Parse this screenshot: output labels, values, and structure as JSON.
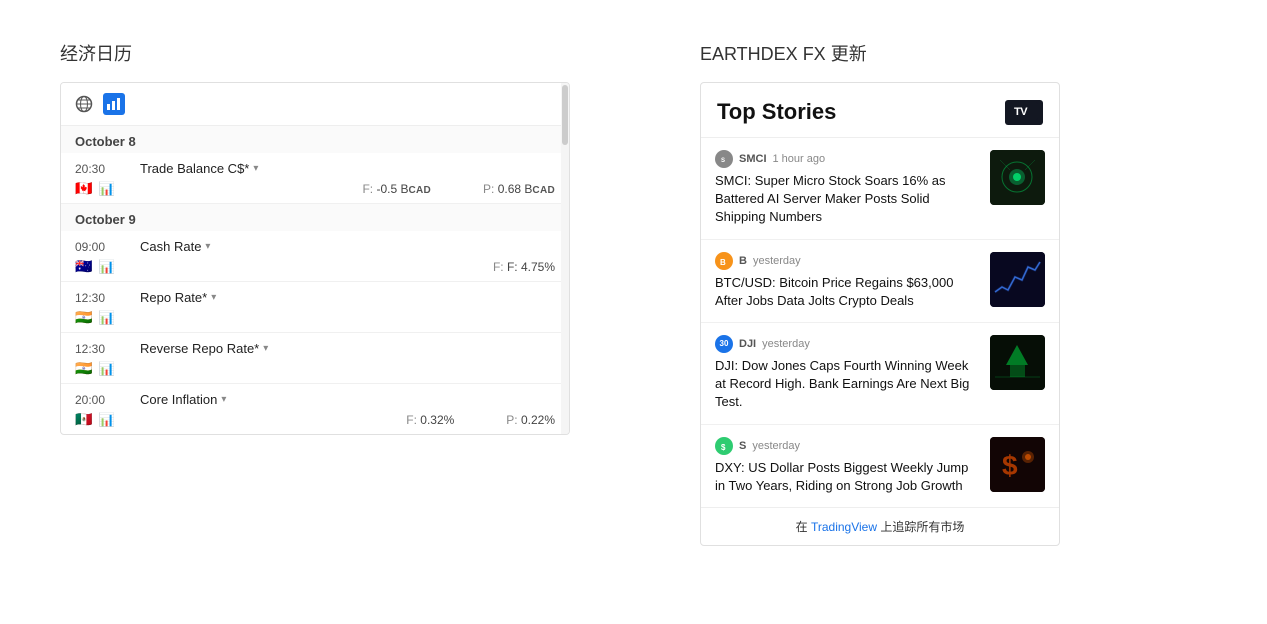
{
  "left": {
    "section_title": "经济日历",
    "calendar": {
      "dates": [
        {
          "date": "October 8",
          "events": [
            {
              "time": "20:30",
              "name": "Trade Balance C$*",
              "flag": "🇨🇦",
              "forecast": "F: -0.5 B",
              "forecast_unit": "CAD",
              "prev": "P: 0.68 B",
              "prev_unit": "CAD"
            }
          ]
        },
        {
          "date": "October 9",
          "events": [
            {
              "time": "09:00",
              "name": "Cash Rate",
              "flag": "🇦🇺",
              "forecast": "F: 4.75%",
              "prev": ""
            },
            {
              "time": "12:30",
              "name": "Repo Rate*",
              "flag": "🇮🇳",
              "forecast": "",
              "prev": ""
            },
            {
              "time": "12:30",
              "name": "Reverse Repo Rate*",
              "flag": "🇮🇳",
              "forecast": "",
              "prev": ""
            },
            {
              "time": "20:00",
              "name": "Core Inflation",
              "flag": "🇲🇽",
              "forecast": "F: 0.32%",
              "prev": "P: 0.22%"
            }
          ]
        }
      ]
    }
  },
  "right": {
    "section_title": "EARTHDEX FX 更新",
    "news": {
      "header": "Top Stories",
      "tv_logo": "TV",
      "items": [
        {
          "ticker": "SMCI",
          "badge_color": "#888",
          "badge_letter": "S",
          "time": "1 hour ago",
          "title": "SMCI: Super Micro Stock Soars 16% as Battered AI Server Maker Posts Solid Shipping Numbers",
          "image_color": "#1a2a1a",
          "image_accent": "#00ff80"
        },
        {
          "ticker": "B",
          "badge_color": "#f7931a",
          "badge_letter": "B",
          "time": "yesterday",
          "title": "BTC/USD: Bitcoin Price Regains $63,000 After Jobs Data Jolts Crypto Deals",
          "image_color": "#0a0a2a",
          "image_accent": "#4444ff"
        },
        {
          "ticker": "30",
          "badge_color": "#1a73e8",
          "badge_letter": "30",
          "time": "yesterday",
          "title": "DJI: Dow Jones Caps Fourth Winning Week at Record High. Bank Earnings Are Next Big Test.",
          "image_color": "#0d1a0d",
          "image_accent": "#00cc44"
        },
        {
          "ticker": "S",
          "badge_color": "#2ecc71",
          "badge_letter": "S",
          "time": "yesterday",
          "title": "DXY: US Dollar Posts Biggest Weekly Jump in Two Years, Riding on Strong Job Growth",
          "image_color": "#1a0a0a",
          "image_accent": "#cc4400"
        }
      ],
      "footer_text": "在 TradingView 上追踪所有市场",
      "footer_link": "TradingView"
    }
  }
}
